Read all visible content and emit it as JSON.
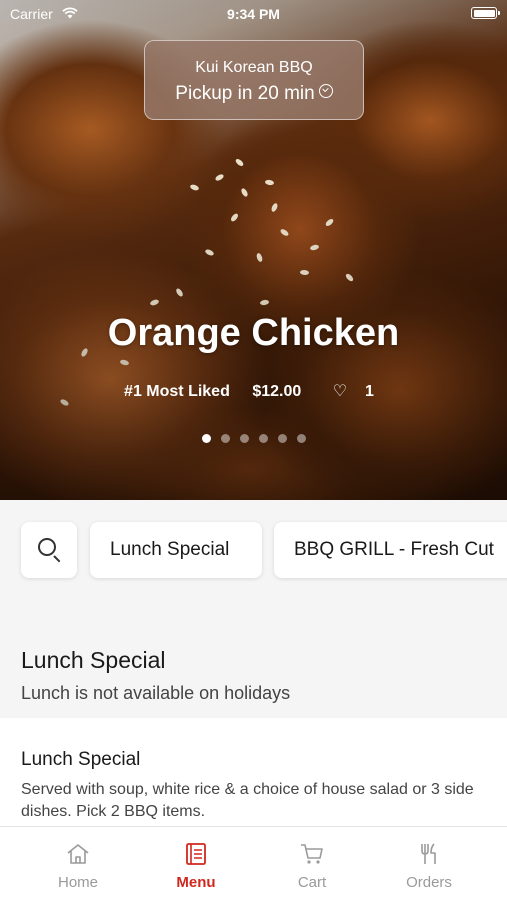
{
  "status_bar": {
    "carrier": "Carrier",
    "time": "9:34 PM"
  },
  "pickup": {
    "restaurant": "Kui Korean BBQ",
    "time_label": "Pickup in 20 min"
  },
  "featured": {
    "title": "Orange Chicken",
    "badge": "#1 Most Liked",
    "price": "$12.00",
    "likes": "1",
    "slide_count": 6,
    "active_slide": 1
  },
  "categories": {
    "items": [
      {
        "label": "Lunch Special"
      },
      {
        "label": "BBQ GRILL - Fresh Cut"
      }
    ]
  },
  "section": {
    "title": "Lunch Special",
    "subtitle": "Lunch is not available on holidays"
  },
  "menu_item": {
    "name": "Lunch Special",
    "description": "Served with soup, white rice & a choice of house salad or 3 side dishes. Pick 2 BBQ items."
  },
  "tab_bar": {
    "active": "Menu",
    "accent_color": "#d0281e",
    "tabs": [
      {
        "label": "Home",
        "icon": "home-icon"
      },
      {
        "label": "Menu",
        "icon": "menu-icon"
      },
      {
        "label": "Cart",
        "icon": "cart-icon"
      },
      {
        "label": "Orders",
        "icon": "fork-knife-icon"
      }
    ]
  }
}
